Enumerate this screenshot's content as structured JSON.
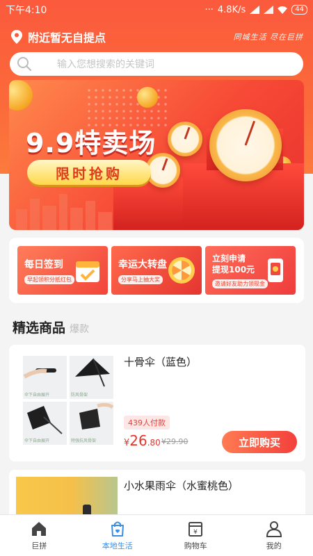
{
  "status_bar": {
    "time": "下午4:10",
    "network": "4.8K/s",
    "battery": "44"
  },
  "header": {
    "location": "附近暂无自提点",
    "slogan": "同城生活 尽在巨拼"
  },
  "search": {
    "placeholder": "输入您想搜索的关键词"
  },
  "banner": {
    "title": "9.9特卖场",
    "tag": "限时抢购"
  },
  "promos": [
    {
      "title": "每日签到",
      "subtitle": "早起领积分抵红包"
    },
    {
      "title": "幸运大转盘",
      "subtitle": "分享马上抽大奖"
    },
    {
      "title": "立刻申请\n提现100元",
      "line1": "立刻申请",
      "line2": "提现100元",
      "subtitle": "邀请好友助力领现金"
    }
  ],
  "section": {
    "title": "精选商品",
    "subtitle": "爆款"
  },
  "products": [
    {
      "title": "十骨伞（蓝色）",
      "sold": "439人付款",
      "price_symbol": "¥",
      "price_int": "26",
      "price_dec": ".80",
      "original_price": "¥29.90",
      "buy_label": "立即购买",
      "image_captions": [
        "伞下自由展开",
        "防风骨架",
        "伞下自由展开",
        "特强抗风骨架"
      ]
    },
    {
      "title": "小水果雨伞（水蜜桃色）"
    }
  ],
  "nav": [
    {
      "label": "巨拼",
      "icon": "home-icon",
      "active": false
    },
    {
      "label": "本地生活",
      "icon": "shopping-bag-icon",
      "active": true
    },
    {
      "label": "购物车",
      "icon": "cart-icon",
      "active": false
    },
    {
      "label": "我的",
      "icon": "user-icon",
      "active": false
    }
  ],
  "colors": {
    "brand": "#fb5a3c",
    "price": "#e2352d",
    "nav_active": "#3a8ee6"
  }
}
